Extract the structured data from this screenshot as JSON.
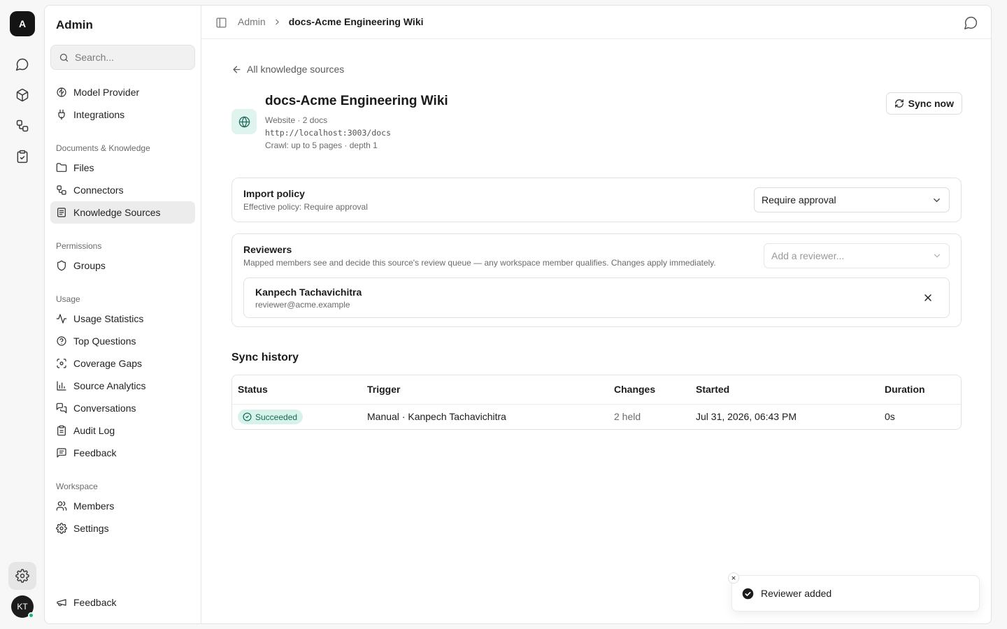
{
  "rail": {
    "logo": "A",
    "avatar": "KT",
    "icons": [
      "chat-icon",
      "cube-icon",
      "workflow-icon",
      "clipboard-icon",
      "gear-icon"
    ]
  },
  "sidebar": {
    "title": "Admin",
    "search_placeholder": "Search...",
    "items_top": [
      {
        "label": "Model Provider",
        "icon": "brain-icon"
      },
      {
        "label": "Integrations",
        "icon": "plug-icon"
      }
    ],
    "groups": [
      {
        "label": "Documents & Knowledge",
        "items": [
          {
            "label": "Files",
            "icon": "folder-icon"
          },
          {
            "label": "Connectors",
            "icon": "workflow-icon"
          },
          {
            "label": "Knowledge Sources",
            "icon": "book-icon",
            "active": true
          }
        ]
      },
      {
        "label": "Permissions",
        "items": [
          {
            "label": "Groups",
            "icon": "shield-icon"
          }
        ]
      },
      {
        "label": "Usage",
        "items": [
          {
            "label": "Usage Statistics",
            "icon": "activity-icon"
          },
          {
            "label": "Top Questions",
            "icon": "question-icon"
          },
          {
            "label": "Coverage Gaps",
            "icon": "scan-icon"
          },
          {
            "label": "Source Analytics",
            "icon": "bar-chart-icon"
          },
          {
            "label": "Conversations",
            "icon": "messages-icon"
          },
          {
            "label": "Audit Log",
            "icon": "clipboard-list-icon"
          },
          {
            "label": "Feedback",
            "icon": "message-square-text-icon"
          }
        ]
      },
      {
        "label": "Workspace",
        "items": [
          {
            "label": "Members",
            "icon": "users-icon"
          },
          {
            "label": "Settings",
            "icon": "gear-icon"
          }
        ]
      }
    ],
    "footer_item": {
      "label": "Feedback",
      "icon": "megaphone-icon"
    }
  },
  "topbar": {
    "breadcrumb": [
      "Admin",
      "docs-Acme Engineering Wiki"
    ]
  },
  "source": {
    "back_label": "All knowledge sources",
    "title": "docs-Acme Engineering Wiki",
    "meta": "Website · 2 docs",
    "url": "http://localhost:3003/docs",
    "crawl": "Crawl: up to 5 pages · depth 1",
    "sync_label": "Sync now"
  },
  "import_policy": {
    "title": "Import policy",
    "subtitle": "Effective policy: Require approval",
    "selected": "Require approval"
  },
  "reviewers": {
    "title": "Reviewers",
    "subtitle": "Mapped members see and decide this source's review queue — any workspace member qualifies. Changes apply immediately.",
    "add_placeholder": "Add a reviewer...",
    "list": [
      {
        "name": "Kanpech Tachavichitra",
        "email": "reviewer@acme.example"
      }
    ]
  },
  "sync_history": {
    "title": "Sync history",
    "columns": [
      "Status",
      "Trigger",
      "Changes",
      "Started",
      "Duration"
    ],
    "rows": [
      {
        "status": "Succeeded",
        "trigger": "Manual · Kanpech Tachavichitra",
        "changes": "2 held",
        "started": "Jul 31, 2026, 06:43 PM",
        "duration": "0s"
      }
    ]
  },
  "toast": {
    "message": "Reviewer added"
  },
  "colors": {
    "accent_green": "#12b981",
    "badge_bg": "#d7f2ea",
    "badge_text": "#136a56"
  }
}
